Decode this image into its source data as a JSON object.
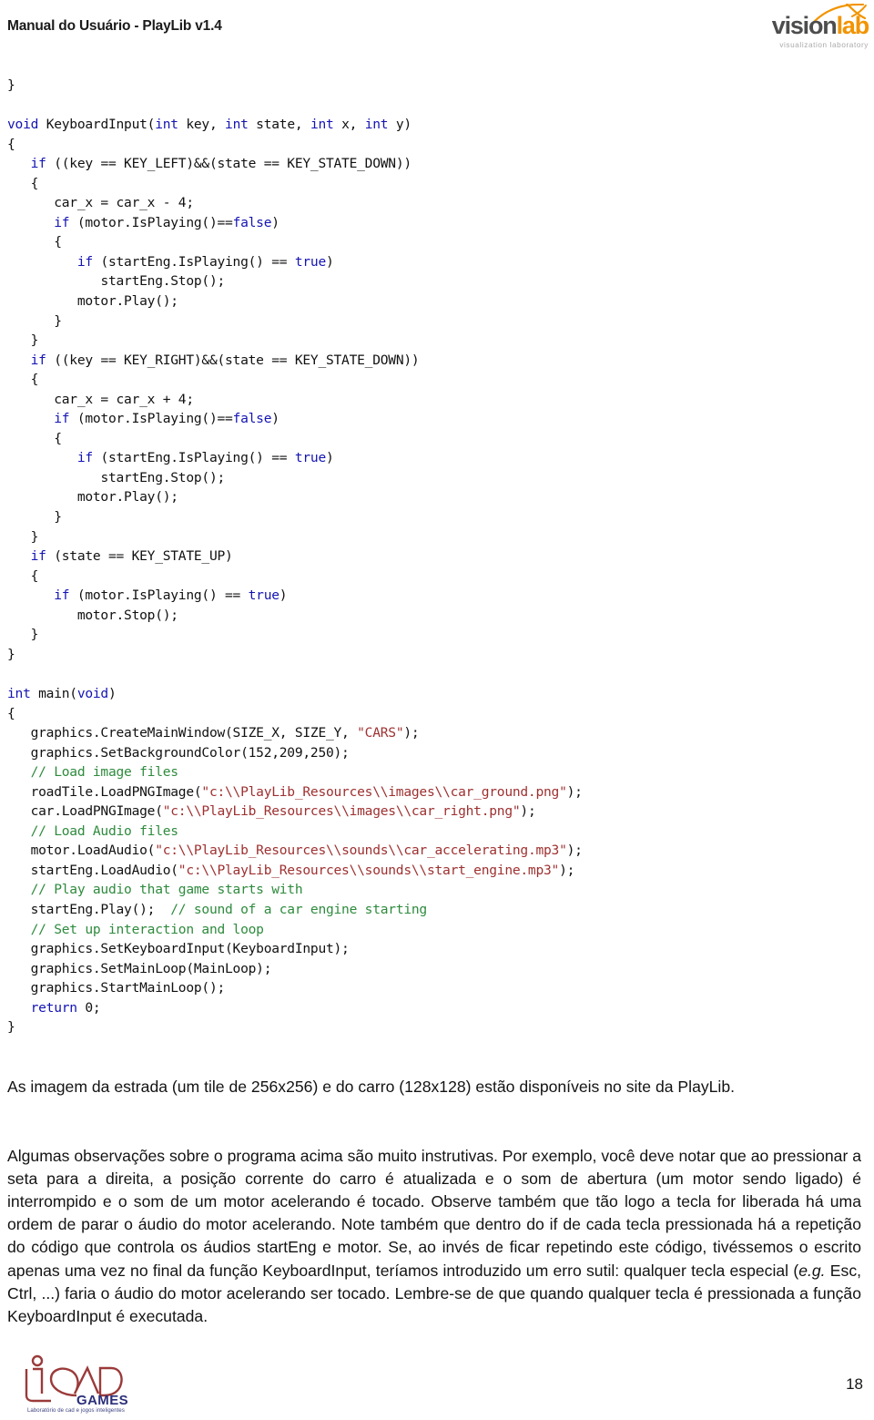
{
  "header": {
    "title": "Manual do Usuário - PlayLib v1.4",
    "logo": {
      "name": "visionlab-logo",
      "word_primary": "vision",
      "word_secondary": "lab",
      "tagline": "visualization laboratory",
      "color_primary": "#4d4d4d",
      "color_secondary": "#f29400",
      "tagline_color": "#a9a9a9"
    }
  },
  "code": {
    "language": "C++",
    "colors": {
      "keyword": "#1414b4",
      "string": "#9e3030",
      "comment": "#2e8b3d",
      "plain": "#111111"
    },
    "lines": [
      {
        "indent": 0,
        "tokens": [
          {
            "t": "plain",
            "v": "}"
          }
        ]
      },
      {
        "indent": 0,
        "tokens": [
          {
            "t": "plain",
            "v": ""
          }
        ]
      },
      {
        "indent": 0,
        "tokens": [
          {
            "t": "kw",
            "v": "void"
          },
          {
            "t": "plain",
            "v": " KeyboardInput("
          },
          {
            "t": "kw",
            "v": "int"
          },
          {
            "t": "plain",
            "v": " key, "
          },
          {
            "t": "kw",
            "v": "int"
          },
          {
            "t": "plain",
            "v": " state, "
          },
          {
            "t": "kw",
            "v": "int"
          },
          {
            "t": "plain",
            "v": " x, "
          },
          {
            "t": "kw",
            "v": "int"
          },
          {
            "t": "plain",
            "v": " y)"
          }
        ]
      },
      {
        "indent": 0,
        "tokens": [
          {
            "t": "plain",
            "v": "{"
          }
        ]
      },
      {
        "indent": 1,
        "tokens": [
          {
            "t": "kw",
            "v": "if"
          },
          {
            "t": "plain",
            "v": " ((key == KEY_LEFT)&&(state == KEY_STATE_DOWN))"
          }
        ]
      },
      {
        "indent": 1,
        "tokens": [
          {
            "t": "plain",
            "v": "{"
          }
        ]
      },
      {
        "indent": 2,
        "tokens": [
          {
            "t": "plain",
            "v": "car_x = car_x - 4;"
          }
        ]
      },
      {
        "indent": 2,
        "tokens": [
          {
            "t": "kw",
            "v": "if"
          },
          {
            "t": "plain",
            "v": " (motor.IsPlaying()=="
          },
          {
            "t": "kw",
            "v": "false"
          },
          {
            "t": "plain",
            "v": ")"
          }
        ]
      },
      {
        "indent": 2,
        "tokens": [
          {
            "t": "plain",
            "v": "{"
          }
        ]
      },
      {
        "indent": 3,
        "tokens": [
          {
            "t": "kw",
            "v": "if"
          },
          {
            "t": "plain",
            "v": " (startEng.IsPlaying() == "
          },
          {
            "t": "kw",
            "v": "true"
          },
          {
            "t": "plain",
            "v": ")"
          }
        ]
      },
      {
        "indent": 4,
        "tokens": [
          {
            "t": "plain",
            "v": "startEng.Stop();"
          }
        ]
      },
      {
        "indent": 3,
        "tokens": [
          {
            "t": "plain",
            "v": "motor.Play();"
          }
        ]
      },
      {
        "indent": 2,
        "tokens": [
          {
            "t": "plain",
            "v": "}"
          }
        ]
      },
      {
        "indent": 1,
        "tokens": [
          {
            "t": "plain",
            "v": "}"
          }
        ]
      },
      {
        "indent": 1,
        "tokens": [
          {
            "t": "kw",
            "v": "if"
          },
          {
            "t": "plain",
            "v": " ((key == KEY_RIGHT)&&(state == KEY_STATE_DOWN))"
          }
        ]
      },
      {
        "indent": 1,
        "tokens": [
          {
            "t": "plain",
            "v": "{"
          }
        ]
      },
      {
        "indent": 2,
        "tokens": [
          {
            "t": "plain",
            "v": "car_x = car_x + 4;"
          }
        ]
      },
      {
        "indent": 2,
        "tokens": [
          {
            "t": "kw",
            "v": "if"
          },
          {
            "t": "plain",
            "v": " (motor.IsPlaying()=="
          },
          {
            "t": "kw",
            "v": "false"
          },
          {
            "t": "plain",
            "v": ")"
          }
        ]
      },
      {
        "indent": 2,
        "tokens": [
          {
            "t": "plain",
            "v": "{"
          }
        ]
      },
      {
        "indent": 3,
        "tokens": [
          {
            "t": "kw",
            "v": "if"
          },
          {
            "t": "plain",
            "v": " (startEng.IsPlaying() == "
          },
          {
            "t": "kw",
            "v": "true"
          },
          {
            "t": "plain",
            "v": ")"
          }
        ]
      },
      {
        "indent": 4,
        "tokens": [
          {
            "t": "plain",
            "v": "startEng.Stop();"
          }
        ]
      },
      {
        "indent": 3,
        "tokens": [
          {
            "t": "plain",
            "v": "motor.Play();"
          }
        ]
      },
      {
        "indent": 2,
        "tokens": [
          {
            "t": "plain",
            "v": "}"
          }
        ]
      },
      {
        "indent": 1,
        "tokens": [
          {
            "t": "plain",
            "v": "}"
          }
        ]
      },
      {
        "indent": 1,
        "tokens": [
          {
            "t": "kw",
            "v": "if"
          },
          {
            "t": "plain",
            "v": " (state == KEY_STATE_UP)"
          }
        ]
      },
      {
        "indent": 1,
        "tokens": [
          {
            "t": "plain",
            "v": "{"
          }
        ]
      },
      {
        "indent": 2,
        "tokens": [
          {
            "t": "kw",
            "v": "if"
          },
          {
            "t": "plain",
            "v": " (motor.IsPlaying() == "
          },
          {
            "t": "kw",
            "v": "true"
          },
          {
            "t": "plain",
            "v": ")"
          }
        ]
      },
      {
        "indent": 3,
        "tokens": [
          {
            "t": "plain",
            "v": "motor.Stop();"
          }
        ]
      },
      {
        "indent": 1,
        "tokens": [
          {
            "t": "plain",
            "v": "}"
          }
        ]
      },
      {
        "indent": 0,
        "tokens": [
          {
            "t": "plain",
            "v": "}"
          }
        ]
      },
      {
        "indent": 0,
        "tokens": [
          {
            "t": "plain",
            "v": ""
          }
        ]
      },
      {
        "indent": 0,
        "tokens": [
          {
            "t": "kw",
            "v": "int"
          },
          {
            "t": "plain",
            "v": " main("
          },
          {
            "t": "kw",
            "v": "void"
          },
          {
            "t": "plain",
            "v": ")"
          }
        ]
      },
      {
        "indent": 0,
        "tokens": [
          {
            "t": "plain",
            "v": "{"
          }
        ]
      },
      {
        "indent": 1,
        "tokens": [
          {
            "t": "plain",
            "v": "graphics.CreateMainWindow(SIZE_X, SIZE_Y, "
          },
          {
            "t": "str",
            "v": "\"CARS\""
          },
          {
            "t": "plain",
            "v": ");"
          }
        ]
      },
      {
        "indent": 1,
        "tokens": [
          {
            "t": "plain",
            "v": "graphics.SetBackgroundColor(152,209,250);"
          }
        ]
      },
      {
        "indent": 1,
        "tokens": [
          {
            "t": "cmt",
            "v": "// Load image files"
          }
        ]
      },
      {
        "indent": 1,
        "tokens": [
          {
            "t": "plain",
            "v": "roadTile.LoadPNGImage("
          },
          {
            "t": "str",
            "v": "\"c:\\\\PlayLib_Resources\\\\images\\\\car_ground.png\""
          },
          {
            "t": "plain",
            "v": ");"
          }
        ]
      },
      {
        "indent": 1,
        "tokens": [
          {
            "t": "plain",
            "v": "car.LoadPNGImage("
          },
          {
            "t": "str",
            "v": "\"c:\\\\PlayLib_Resources\\\\images\\\\car_right.png\""
          },
          {
            "t": "plain",
            "v": ");"
          }
        ]
      },
      {
        "indent": 1,
        "tokens": [
          {
            "t": "cmt",
            "v": "// Load Audio files"
          }
        ]
      },
      {
        "indent": 1,
        "tokens": [
          {
            "t": "plain",
            "v": "motor.LoadAudio("
          },
          {
            "t": "str",
            "v": "\"c:\\\\PlayLib_Resources\\\\sounds\\\\car_accelerating.mp3\""
          },
          {
            "t": "plain",
            "v": ");"
          }
        ]
      },
      {
        "indent": 1,
        "tokens": [
          {
            "t": "plain",
            "v": "startEng.LoadAudio("
          },
          {
            "t": "str",
            "v": "\"c:\\\\PlayLib_Resources\\\\sounds\\\\start_engine.mp3\""
          },
          {
            "t": "plain",
            "v": ");"
          }
        ]
      },
      {
        "indent": 1,
        "tokens": [
          {
            "t": "cmt",
            "v": "// Play audio that game starts with"
          }
        ]
      },
      {
        "indent": 1,
        "tokens": [
          {
            "t": "plain",
            "v": "startEng.Play();  "
          },
          {
            "t": "cmt",
            "v": "// sound of a car engine starting"
          }
        ]
      },
      {
        "indent": 1,
        "tokens": [
          {
            "t": "cmt",
            "v": "// Set up interaction and loop"
          }
        ]
      },
      {
        "indent": 1,
        "tokens": [
          {
            "t": "plain",
            "v": "graphics.SetKeyboardInput(KeyboardInput);"
          }
        ]
      },
      {
        "indent": 1,
        "tokens": [
          {
            "t": "plain",
            "v": "graphics.SetMainLoop(MainLoop);"
          }
        ]
      },
      {
        "indent": 1,
        "tokens": [
          {
            "t": "plain",
            "v": "graphics.StartMainLoop();"
          }
        ]
      },
      {
        "indent": 1,
        "tokens": [
          {
            "t": "kw",
            "v": "return"
          },
          {
            "t": "plain",
            "v": " 0;"
          }
        ]
      },
      {
        "indent": 0,
        "tokens": [
          {
            "t": "plain",
            "v": "}"
          }
        ]
      }
    ]
  },
  "body": {
    "paragraph_images": "As imagem da estrada (um tile de 256x256) e do carro (128x128) estão disponíveis no site da PlayLib.",
    "paragraph_notes_part1": "Algumas observações sobre o programa acima são muito instrutivas. Por exemplo, você deve notar que ao pressionar a seta para a direita, a posição corrente do carro é atualizada e o som de abertura (um motor sendo ligado) é interrompido e o som de um motor acelerando é tocado. Observe também que tão logo a tecla for liberada há uma ordem de parar o áudio do motor acelerando. Note também que dentro do if de cada tecla pressionada há a repetição do código que controla os áudios startEng e motor. Se, ao invés de ficar repetindo este código, tivéssemos o escrito apenas uma vez no final da função KeyboardInput, teríamos introduzido um erro sutil: qualquer tecla especial (",
    "paragraph_notes_eg": "e.g.",
    "paragraph_notes_part2": " Esc, Ctrl, ...) faria o áudio do motor acelerando ser tocado. Lembre-se de que quando qualquer tecla é pressionada a função KeyboardInput é executada."
  },
  "footer": {
    "logo": {
      "name": "icad-games-logo",
      "games_word": "GAMES",
      "tagline": "Laboratório de cad e jogos inteligentes",
      "mark_color": "#9b3a3a",
      "word_color": "#2b2f7a"
    },
    "page_number": "18"
  }
}
